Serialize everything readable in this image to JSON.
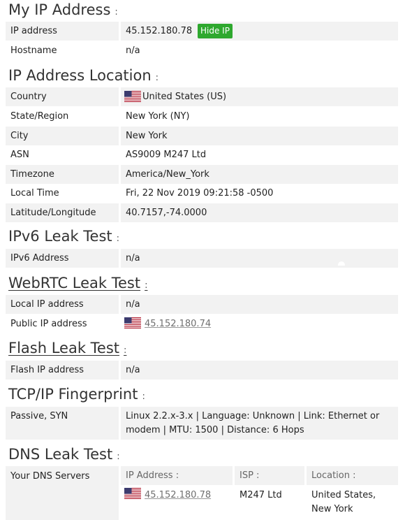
{
  "sections": {
    "my_ip": {
      "title": "My IP Address",
      "colon": ":",
      "rows": [
        {
          "label": "IP address",
          "value": "45.152.180.78",
          "button": "Hide IP"
        },
        {
          "label": "Hostname",
          "value": "n/a"
        }
      ]
    },
    "location": {
      "title": "IP Address Location",
      "colon": ":",
      "rows": [
        {
          "label": "Country",
          "value": "United States (US)",
          "flag": "us-flag-icon"
        },
        {
          "label": "State/Region",
          "value": "New York (NY)"
        },
        {
          "label": "City",
          "value": "New York"
        },
        {
          "label": "ASN",
          "value": "AS9009 M247 Ltd"
        },
        {
          "label": "Timezone",
          "value": "America/New_York"
        },
        {
          "label": "Local Time",
          "value": "Fri, 22 Nov 2019 09:21:58 -0500"
        },
        {
          "label": "Latitude/Longitude",
          "value": "40.7157,-74.0000"
        }
      ]
    },
    "ipv6": {
      "title": "IPv6 Leak Test",
      "colon": ":",
      "rows": [
        {
          "label": "IPv6 Address",
          "value": "n/a"
        }
      ]
    },
    "webrtc": {
      "title": "WebRTC Leak Test",
      "colon": ":",
      "rows": [
        {
          "label": "Local IP address",
          "value": "n/a"
        },
        {
          "label": "Public IP address",
          "value": "45.152.180.74",
          "flag": "us-flag-icon"
        }
      ]
    },
    "flash": {
      "title": "Flash Leak Test",
      "colon": ":",
      "rows": [
        {
          "label": "Flash IP address",
          "value": "n/a"
        }
      ]
    },
    "tcp": {
      "title": "TCP/IP Fingerprint",
      "colon": ":",
      "rows": [
        {
          "label": "Passive, SYN",
          "value_line1": "Linux 2.2.x-3.x | Language: Unknown | Link: Ethernet or",
          "value_line2": "modem | MTU: 1500 | Distance: 6 Hops"
        }
      ]
    },
    "dns": {
      "title": "DNS Leak Test",
      "colon": ":",
      "label": "Your DNS Servers",
      "headers": {
        "ip": "IP Address :",
        "isp": "ISP :",
        "location": "Location :"
      },
      "servers": [
        {
          "ip": "45.152.180.78",
          "isp": "M247 Ltd",
          "location_line1": "United States,",
          "location_line2": "New York",
          "flag": "us-flag-icon"
        }
      ]
    }
  },
  "colors": {
    "button": "#2ea82e",
    "row_bg": "#f2f2f2",
    "link": "#6f6f6f"
  }
}
